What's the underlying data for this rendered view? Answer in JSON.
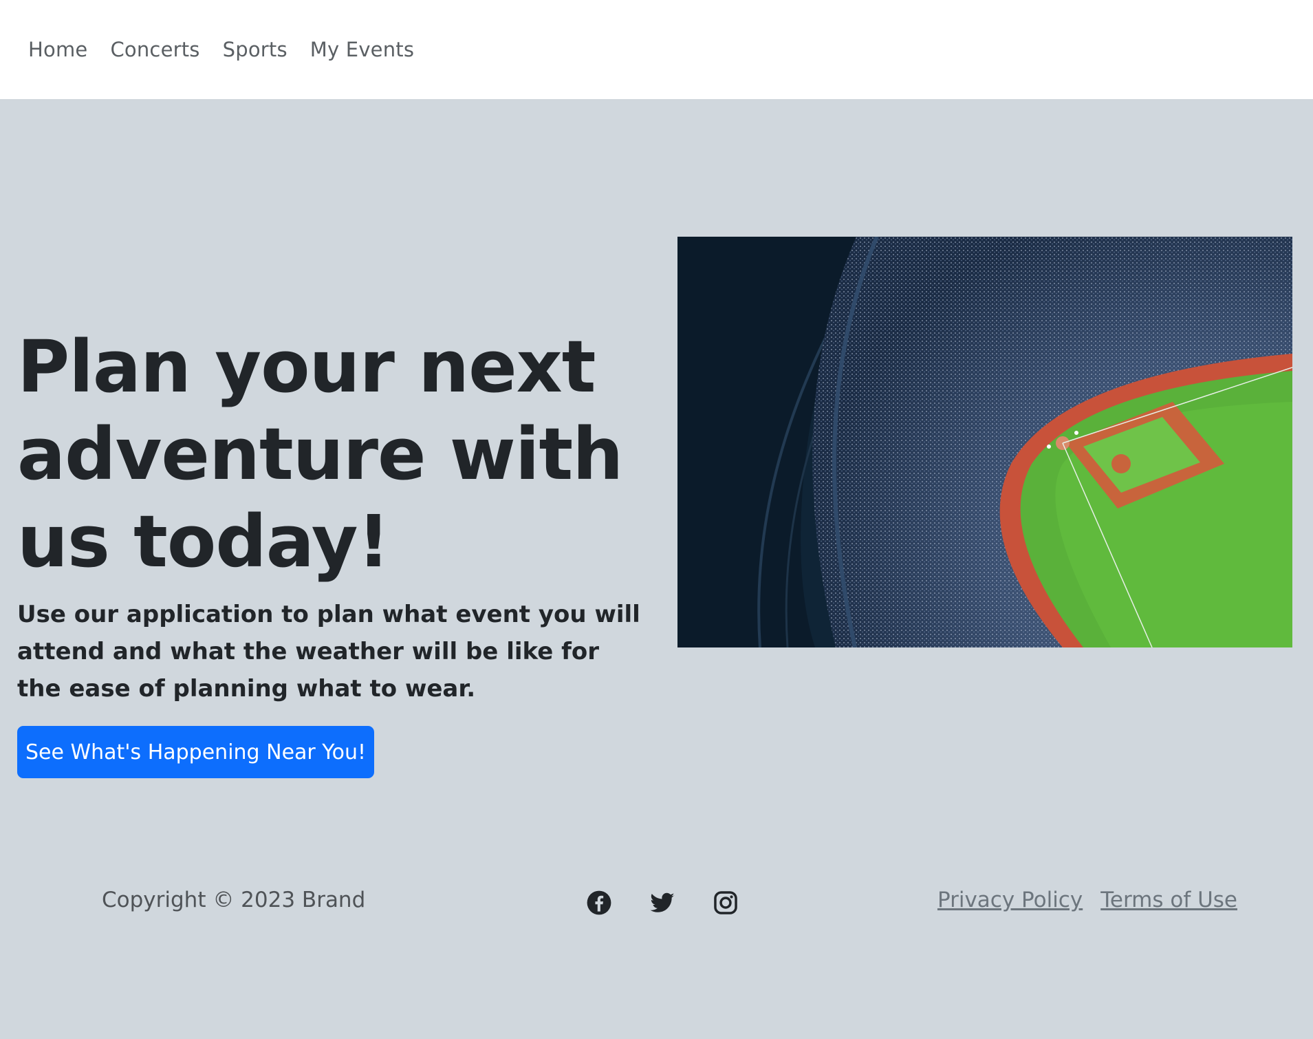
{
  "nav": {
    "items": [
      {
        "label": "Home"
      },
      {
        "label": "Concerts"
      },
      {
        "label": "Sports"
      },
      {
        "label": "My Events"
      }
    ]
  },
  "hero": {
    "title": "Plan your next adventure with us today!",
    "lead": "Use our application to plan what event you will attend and what the weather will be like for the ease of planning what to wear.",
    "cta_label": "See What's Happening Near You!",
    "image_icon": "stadium-photo"
  },
  "footer": {
    "copyright": "Copyright © 2023 Brand",
    "social": [
      {
        "icon": "facebook-icon"
      },
      {
        "icon": "twitter-icon"
      },
      {
        "icon": "instagram-icon"
      }
    ],
    "links": [
      {
        "label": "Privacy Policy"
      },
      {
        "label": "Terms of Use"
      }
    ]
  },
  "colors": {
    "page_background": "#d0d7dd",
    "navbar_background": "#ffffff",
    "primary": "#0d6efd",
    "text": "#212529",
    "muted_link": "#6c757d"
  }
}
